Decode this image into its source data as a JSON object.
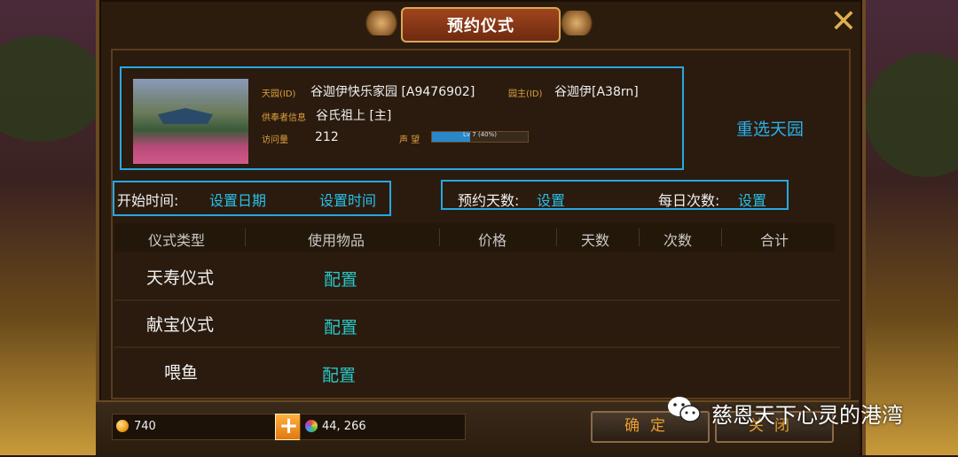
{
  "dialog": {
    "title": "预约仪式"
  },
  "garden": {
    "id_label": "天园(ID)",
    "id_value": "谷迦伊快乐家园 [A9476902]",
    "owner_label": "园主(ID)",
    "owner_value": "谷迦伊[A38rn]",
    "worshipper_label": "供奉者信息",
    "worshipper_value": "谷氏祖上 [主]",
    "visits_label": "访问量",
    "visits_value": "212",
    "reputation_label": "声  望",
    "reputation_text": "Lv 7 (40%)",
    "reputation_fraction": 0.4
  },
  "reselect_label": "重选天园",
  "schedule": {
    "start_time_label": "开始时间:",
    "set_date_label": "设置日期",
    "set_time_label": "设置时间",
    "days_label": "预约天数:",
    "days_value": "设置",
    "daily_label": "每日次数:",
    "daily_value": "设置"
  },
  "table": {
    "headers": [
      "仪式类型",
      "使用物品",
      "价格",
      "天数",
      "次数",
      "合计"
    ],
    "rows": [
      {
        "type": "天寿仪式",
        "item": "配置"
      },
      {
        "type": "献宝仪式",
        "item": "配置"
      },
      {
        "type": "喂鱼",
        "item": "配置"
      }
    ]
  },
  "footer": {
    "gold": "740",
    "gems": "44, 266",
    "plus_label": "+",
    "confirm_label": "确定",
    "close_label": "关闭"
  },
  "watermark": "慈恩天下心灵的港湾",
  "icons": [
    "close-icon",
    "gold-coin-icon",
    "gem-icon",
    "plus-icon",
    "wechat-icon"
  ],
  "colors": {
    "accent": "#28a8e0",
    "gold": "#e0a040",
    "panel": "#2b1c0e"
  }
}
